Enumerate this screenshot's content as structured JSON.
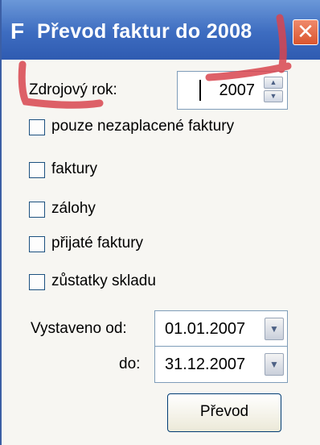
{
  "window": {
    "title": "Převod faktur do 2008",
    "logo": "F",
    "close_glyph": "✕"
  },
  "source_year": {
    "label": "Zdrojový rok:",
    "value": "2007"
  },
  "checkboxes": [
    {
      "label": "pouze nezaplacené faktury",
      "checked": false
    },
    {
      "label": "faktury",
      "checked": false
    },
    {
      "label": "zálohy",
      "checked": false
    },
    {
      "label": "přijaté faktury",
      "checked": false
    },
    {
      "label": "zůstatky skladu",
      "checked": false
    }
  ],
  "issued_from": {
    "label": "Vystaveno od:",
    "value": "01.01.2007"
  },
  "issued_to": {
    "label": "do:",
    "value": "31.12.2007"
  },
  "submit_label": "Převod",
  "icons": {
    "spin_up": "▲",
    "spin_down": "▼",
    "dropdown": "▼"
  },
  "colors": {
    "titlebar": "#3d6cc0",
    "close": "#d9552e",
    "scribble": "#d8454f"
  }
}
